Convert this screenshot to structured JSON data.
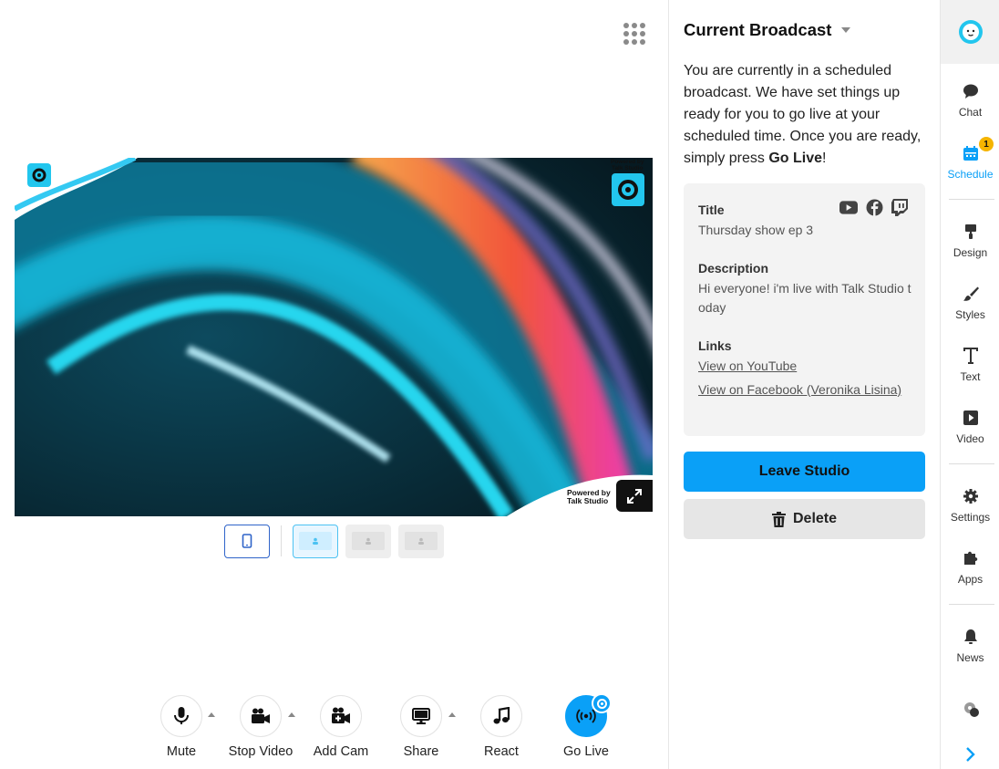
{
  "stage": {
    "powered_by_small": [
      "Powered by",
      "Talk Studio"
    ],
    "powered_by_large": [
      "Powered by",
      "Talk Studio"
    ]
  },
  "controls": [
    {
      "label": "Mute",
      "icon": "microphone-icon"
    },
    {
      "label": "Stop Video",
      "icon": "video-camera-icon"
    },
    {
      "label": "Add Cam",
      "icon": "add-camera-icon"
    },
    {
      "label": "Share",
      "icon": "monitor-icon"
    },
    {
      "label": "React",
      "icon": "music-note-icon"
    },
    {
      "label": "Go Live",
      "icon": "broadcast-icon"
    }
  ],
  "panel": {
    "title": "Current Broadcast",
    "intro_text": "You are currently in a scheduled broadcast. We have set things up ready for you to go live at your scheduled time. Once you are ready, simply press ",
    "intro_bold": "Go Live",
    "intro_end": "!",
    "title_label": "Title",
    "title_value": "Thursday show ep 3",
    "description_label": "Description",
    "description_value": "Hi everyone! i'm live with Talk Studio today",
    "links_label": "Links",
    "link_youtube": "View on YouTube",
    "link_facebook": "View on Facebook (Veronika Lisina)",
    "leave_button": "Leave Studio",
    "delete_button": "Delete"
  },
  "sidenav": {
    "items": [
      {
        "label": "Chat",
        "icon": "chat-bubble-icon"
      },
      {
        "label": "Schedule",
        "icon": "calendar-icon",
        "badge": "1"
      },
      {
        "label": "Design",
        "icon": "paint-roller-icon"
      },
      {
        "label": "Styles",
        "icon": "brush-icon"
      },
      {
        "label": "Text",
        "icon": "text-icon"
      },
      {
        "label": "Video",
        "icon": "play-icon"
      },
      {
        "label": "Settings",
        "icon": "gear-icon"
      },
      {
        "label": "Apps",
        "icon": "puzzle-icon"
      },
      {
        "label": "News",
        "icon": "bell-icon"
      }
    ]
  },
  "colors": {
    "accent": "#0aa0f7",
    "badge": "#f5b400",
    "brand_cyan": "#22c6ee"
  }
}
